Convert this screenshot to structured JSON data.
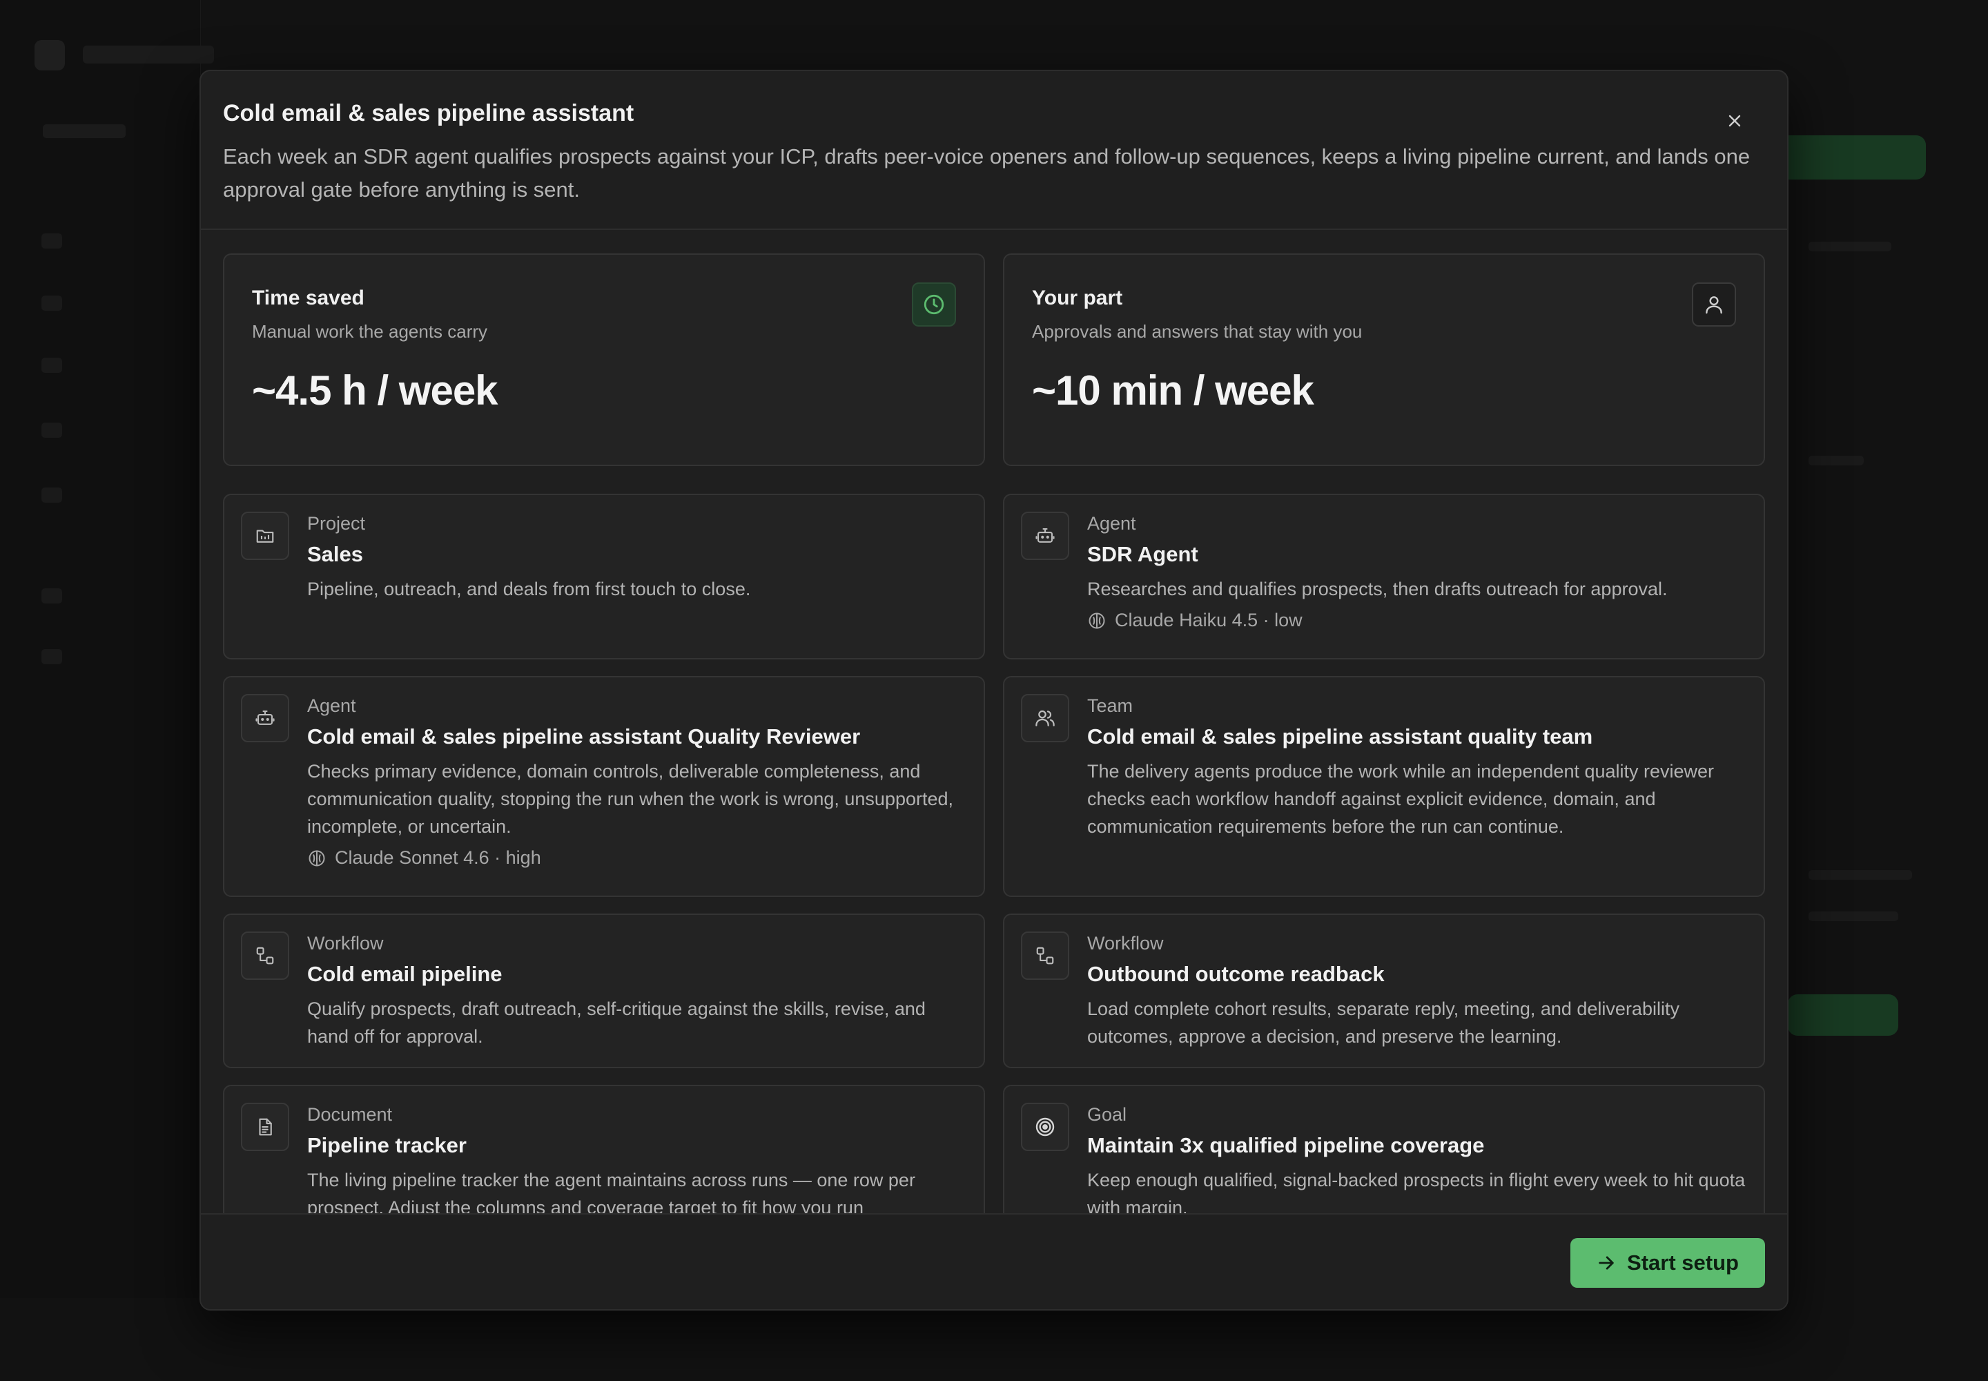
{
  "modal": {
    "title": "Cold email & sales pipeline assistant",
    "description": "Each week an SDR agent qualifies prospects against your ICP, drafts peer-voice openers and follow-up sequences, keeps a living pipeline current, and lands one approval gate before anything is sent.",
    "close_icon": "close-icon"
  },
  "stats": {
    "time_saved": {
      "title": "Time saved",
      "subtitle": "Manual work the agents carry",
      "value": "~4.5 h / week",
      "icon": "clock-icon",
      "accent": "#5cbc6f"
    },
    "your_part": {
      "title": "Your part",
      "subtitle": "Approvals and answers that stay with you",
      "value": "~10 min / week",
      "icon": "user-icon"
    }
  },
  "items": [
    {
      "type": "Project",
      "title": "Sales",
      "description": "Pipeline, outreach, and deals from first touch to close.",
      "icon": "folder-icon"
    },
    {
      "type": "Agent",
      "title": "SDR Agent",
      "description": "Researches and qualifies prospects, then drafts outreach for approval.",
      "model": "Claude Haiku 4.5 · low",
      "icon": "bot-icon"
    },
    {
      "type": "Agent",
      "title": "Cold email & sales pipeline assistant Quality Reviewer",
      "description": "Checks primary evidence, domain controls, deliverable completeness, and communication quality, stopping the run when the work is wrong, unsupported, incomplete, or uncertain.",
      "model": "Claude Sonnet 4.6 · high",
      "icon": "bot-icon"
    },
    {
      "type": "Team",
      "title": "Cold email & sales pipeline assistant quality team",
      "description": "The delivery agents produce the work while an independent quality reviewer checks each workflow handoff against explicit evidence, domain, and communication requirements before the run can continue.",
      "icon": "users-icon"
    },
    {
      "type": "Workflow",
      "title": "Cold email pipeline",
      "description": "Qualify prospects, draft outreach, self-critique against the skills, revise, and hand off for approval.",
      "icon": "workflow-icon"
    },
    {
      "type": "Workflow",
      "title": "Outbound outcome readback",
      "description": "Load complete cohort results, separate reply, meeting, and deliverability outcomes, approve a decision, and preserve the learning.",
      "icon": "workflow-icon"
    },
    {
      "type": "Document",
      "title": "Pipeline tracker",
      "description": "The living pipeline tracker the agent maintains across runs — one row per prospect. Adjust the columns and coverage target to fit how you run",
      "icon": "document-icon"
    },
    {
      "type": "Goal",
      "title": "Maintain 3x qualified pipeline coverage",
      "description": "Keep enough qualified, signal-backed prospects in flight every week to hit quota with margin.",
      "icon": "target-icon"
    }
  ],
  "footer": {
    "start_label": "Start setup",
    "start_icon": "arrow-right-icon",
    "accent": "#5cbc6f"
  }
}
